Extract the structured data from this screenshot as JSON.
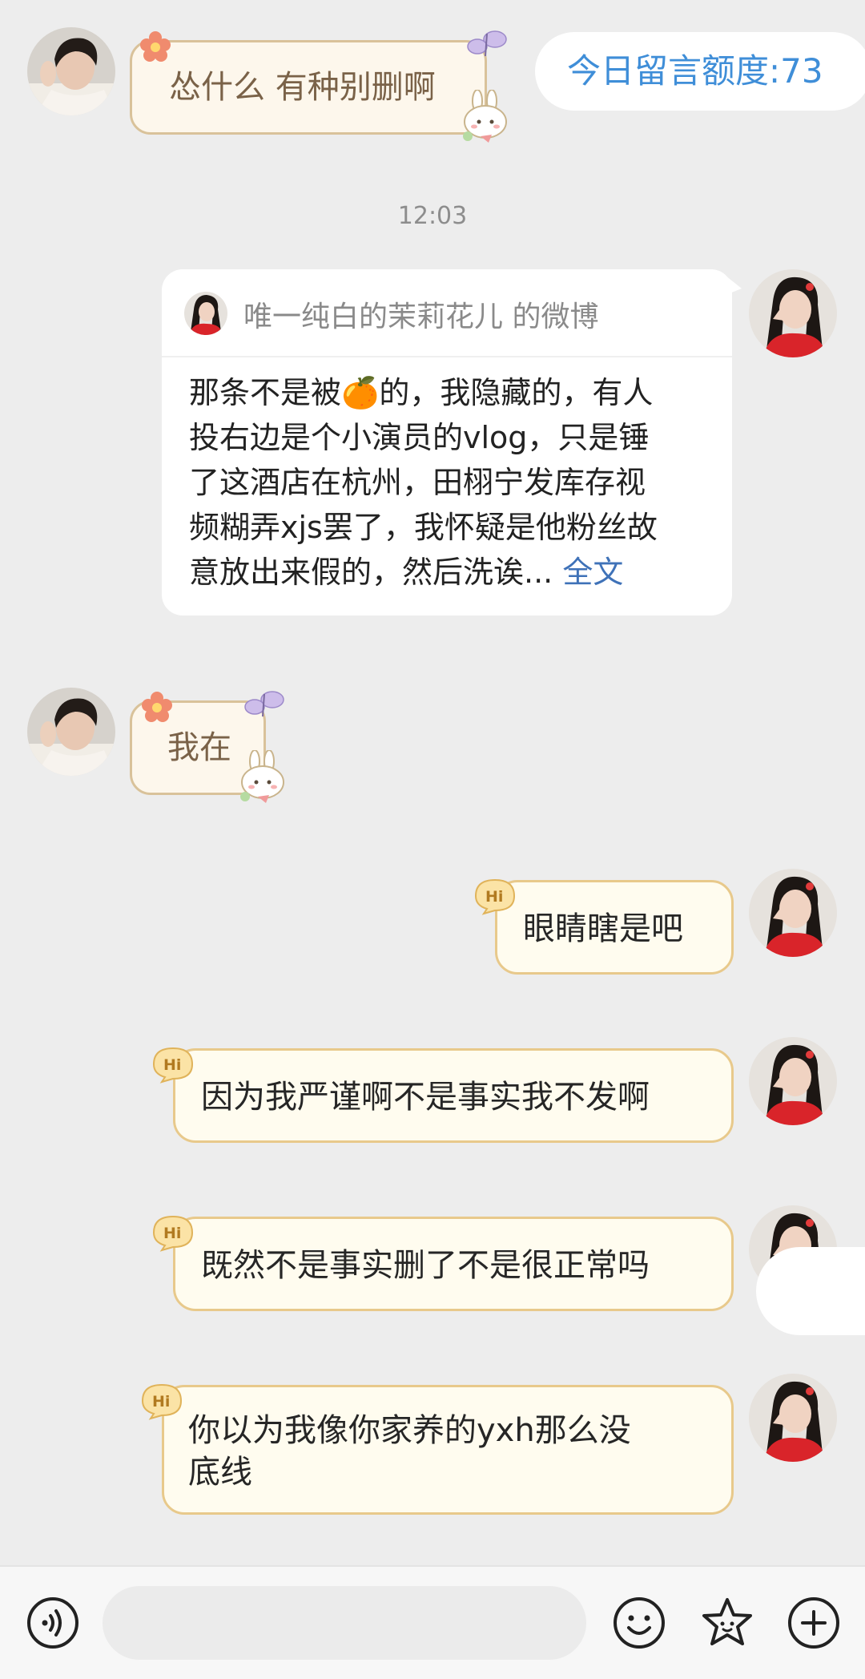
{
  "quota": {
    "label": "今日留言额度:73"
  },
  "time": "12:03",
  "messages": {
    "m1": "怂什么 有种别删啊",
    "m2": "我在",
    "m3": "眼睛瞎是吧",
    "m4": "因为我严谨啊不是事实我不发啊",
    "m5": "既然不是事实删了不是很正常吗",
    "m6_line1": "你以为我像你家养的yxh那么没",
    "m6_line2": "底线"
  },
  "badge_label": "Hi",
  "share_card": {
    "source": "唯一纯白的茉莉花儿 的微博",
    "lines": [
      "那条不是被",
      "的，我隐藏的，有人",
      "投右边是个小演员的vlog，只是锤",
      "了这酒店在杭州，田栩宁发库存视",
      "频糊弄xjs罢了，我怀疑是他粉丝故",
      "意放出来假的，然后洗诶..."
    ],
    "more": "全文",
    "emoji": "🍊"
  },
  "icons": {
    "voice": "voice-icon",
    "emoji": "smiley-icon",
    "sticker": "star-sticker-icon",
    "plus": "plus-icon"
  },
  "colors": {
    "background": "#ededed",
    "quota_text": "#3f8ed8",
    "cute_bubble_border": "#d9c29a",
    "hi_bubble_border": "#e8c98b",
    "link": "#3f72b8"
  }
}
